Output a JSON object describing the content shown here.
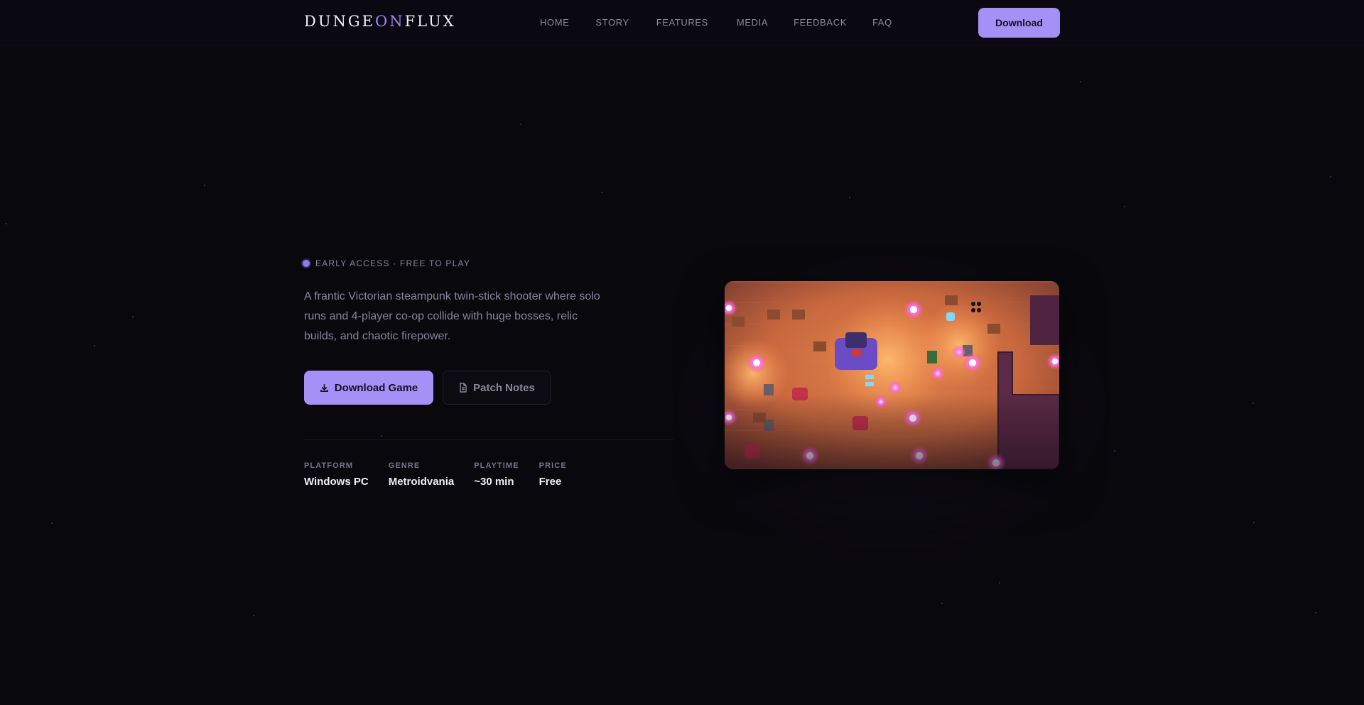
{
  "brand": {
    "logo_part1": "DUNGE",
    "logo_accent": "ON",
    "logo_part2": "FLUX",
    "accent_color": "#a391f6"
  },
  "nav": {
    "links": [
      "HOME",
      "STORY",
      "FEATURES",
      "MEDIA",
      "FEEDBACK",
      "FAQ"
    ],
    "download_label": "Download"
  },
  "hero": {
    "badge": "EARLY ACCESS · FREE TO PLAY",
    "tagline": "A frantic Victorian steampunk twin-stick shooter where solo runs and 4-player co-op collide with huge bosses, relic builds, and chaotic firepower.",
    "primary_button": {
      "label": "Download Game",
      "icon": "download-icon"
    },
    "secondary_button": {
      "label": "Patch Notes",
      "icon": "document-icon"
    },
    "meta": [
      {
        "label": "PLATFORM",
        "value": "Windows PC"
      },
      {
        "label": "GENRE",
        "value": "Metroidvania"
      },
      {
        "label": "PLAYTIME",
        "value": "~30 min"
      },
      {
        "label": "PRICE",
        "value": "Free"
      }
    ],
    "screenshot": {
      "kind": "gameplay-screenshot"
    }
  }
}
